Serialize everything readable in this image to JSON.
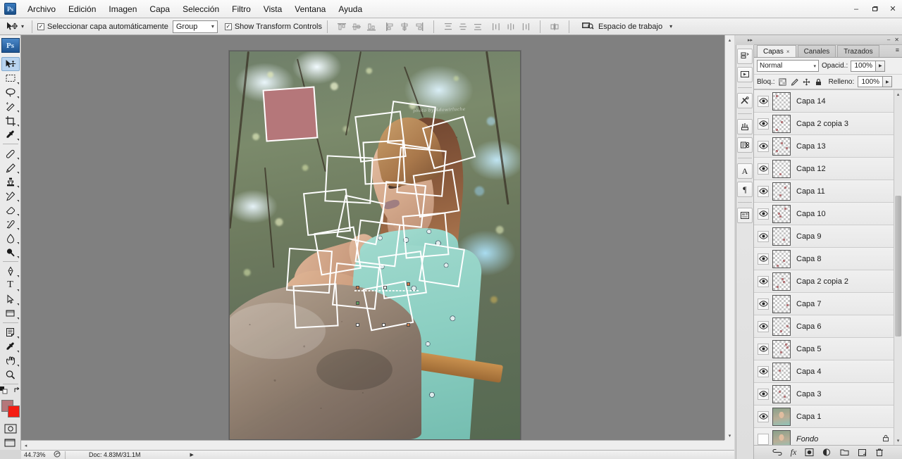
{
  "window": {
    "app_icon": "photoshop-logo",
    "minimize": "–",
    "restore": "❐",
    "close": "✕"
  },
  "menubar": {
    "items": [
      "Archivo",
      "Edición",
      "Imagen",
      "Capa",
      "Selección",
      "Filtro",
      "Vista",
      "Ventana",
      "Ayuda"
    ]
  },
  "options_bar": {
    "tool_icon": "move-tool-icon",
    "auto_select_label": "Seleccionar capa automáticamente",
    "auto_select_checked": "✓",
    "group_select_value": "Group",
    "show_transform_label": "Show Transform Controls",
    "show_transform_checked": "✓",
    "workspace_label": "Espacio de trabajo",
    "workspace_caret": "▾"
  },
  "toolbox": {
    "logo": "Ps",
    "tools": [
      {
        "name": "move-tool",
        "active": true
      },
      {
        "name": "rectangular-marquee-tool",
        "active": false
      },
      {
        "name": "lasso-tool",
        "active": false
      },
      {
        "name": "quick-selection-tool",
        "active": false
      },
      {
        "name": "crop-tool",
        "active": false
      },
      {
        "name": "eyedropper-tool",
        "active": false
      },
      {
        "name": "spot-healing-brush-tool",
        "active": false
      },
      {
        "name": "brush-tool",
        "active": false
      },
      {
        "name": "clone-stamp-tool",
        "active": false
      },
      {
        "name": "history-brush-tool",
        "active": false
      },
      {
        "name": "eraser-tool",
        "active": false
      },
      {
        "name": "gradient-tool",
        "active": false
      },
      {
        "name": "blur-tool",
        "active": false
      },
      {
        "name": "dodge-tool",
        "active": false
      },
      {
        "name": "pen-tool",
        "active": false
      },
      {
        "name": "type-tool",
        "active": false
      },
      {
        "name": "path-selection-tool",
        "active": false
      },
      {
        "name": "rectangle-shape-tool",
        "active": false
      },
      {
        "name": "notes-tool",
        "active": false
      },
      {
        "name": "eyedropper-tool-2",
        "active": false
      },
      {
        "name": "hand-tool",
        "active": false
      },
      {
        "name": "zoom-tool",
        "active": false
      }
    ],
    "type_glyph": "T",
    "foreground_color": "#b5777a",
    "background_color": "#f41c12",
    "quick_mask_label": "quick-mask-mode",
    "screen_mode_label": "screen-mode"
  },
  "canvas": {
    "document_zoom": "44.73%",
    "watermark": "photo by Adowirluche",
    "fill_square_color": "#b5777a",
    "frame_stroke_color": "#ffffff"
  },
  "status_bar": {
    "zoom": "44.73%",
    "doc_info": "Doc: 4.83M/31.1M",
    "expand_caret": "▶"
  },
  "icon_dock": {
    "collapse": "▸▸",
    "buttons": [
      {
        "name": "history-panel-icon"
      },
      {
        "name": "actions-panel-icon"
      },
      {
        "name": "tool-presets-icon"
      },
      {
        "name": "brushes-panel-icon"
      },
      {
        "name": "clone-source-icon"
      },
      {
        "name": "character-panel-icon",
        "glyph": "A"
      },
      {
        "name": "paragraph-panel-icon",
        "glyph": "¶"
      },
      {
        "name": "layer-comps-icon"
      }
    ]
  },
  "layers_panel": {
    "minimize": "–",
    "close": "✕",
    "menu": "≡",
    "tabs": [
      {
        "label": "Capas",
        "close": "×",
        "active": true
      },
      {
        "label": "Canales",
        "active": false
      },
      {
        "label": "Trazados",
        "active": false
      }
    ],
    "blend_mode": "Normal",
    "opacity_label": "Opacid.:",
    "opacity_value": "100%",
    "lock_label": "Bloq.:",
    "lock_icons": [
      "lock-transparent-pixels-icon",
      "lock-image-pixels-icon",
      "lock-position-icon",
      "lock-all-icon"
    ],
    "fill_label": "Relleno:",
    "fill_value": "100%",
    "layers": [
      {
        "name": "Capa 14",
        "visible": true,
        "type": "transparent",
        "locked": false,
        "italic": false
      },
      {
        "name": "Capa 2 copia 3",
        "visible": true,
        "type": "transparent",
        "locked": false,
        "italic": false
      },
      {
        "name": "Capa 13",
        "visible": true,
        "type": "transparent",
        "locked": false,
        "italic": false
      },
      {
        "name": "Capa 12",
        "visible": true,
        "type": "transparent",
        "locked": false,
        "italic": false
      },
      {
        "name": "Capa 11",
        "visible": true,
        "type": "transparent",
        "locked": false,
        "italic": false
      },
      {
        "name": "Capa 10",
        "visible": true,
        "type": "transparent",
        "locked": false,
        "italic": false
      },
      {
        "name": "Capa 9",
        "visible": true,
        "type": "transparent",
        "locked": false,
        "italic": false
      },
      {
        "name": "Capa 8",
        "visible": true,
        "type": "transparent",
        "locked": false,
        "italic": false
      },
      {
        "name": "Capa 2 copia 2",
        "visible": true,
        "type": "transparent",
        "locked": false,
        "italic": false
      },
      {
        "name": "Capa 7",
        "visible": true,
        "type": "transparent",
        "locked": false,
        "italic": false
      },
      {
        "name": "Capa 6",
        "visible": true,
        "type": "transparent",
        "locked": false,
        "italic": false
      },
      {
        "name": "Capa 5",
        "visible": true,
        "type": "transparent",
        "locked": false,
        "italic": false
      },
      {
        "name": "Capa 4",
        "visible": true,
        "type": "transparent",
        "locked": false,
        "italic": false
      },
      {
        "name": "Capa 3",
        "visible": true,
        "type": "transparent",
        "locked": false,
        "italic": false
      },
      {
        "name": "Capa 1",
        "visible": true,
        "type": "photo",
        "locked": false,
        "italic": false
      },
      {
        "name": "Fondo",
        "visible": false,
        "type": "photo",
        "locked": true,
        "italic": true
      }
    ],
    "eye_glyph": "◉",
    "lock_glyph": "🔒",
    "footer_buttons": [
      {
        "name": "link-layers-icon",
        "glyph": "⚭"
      },
      {
        "name": "layer-style-icon",
        "glyph": "fx"
      },
      {
        "name": "layer-mask-icon",
        "glyph": "▣"
      },
      {
        "name": "adjustment-layer-icon",
        "glyph": "◐"
      },
      {
        "name": "new-group-icon",
        "glyph": "▭"
      },
      {
        "name": "new-layer-icon",
        "glyph": "⧉"
      },
      {
        "name": "delete-layer-icon",
        "glyph": "🗑"
      }
    ]
  },
  "scrollbars": {
    "up": "▴",
    "down": "▾",
    "left": "◂",
    "right": "▸"
  }
}
